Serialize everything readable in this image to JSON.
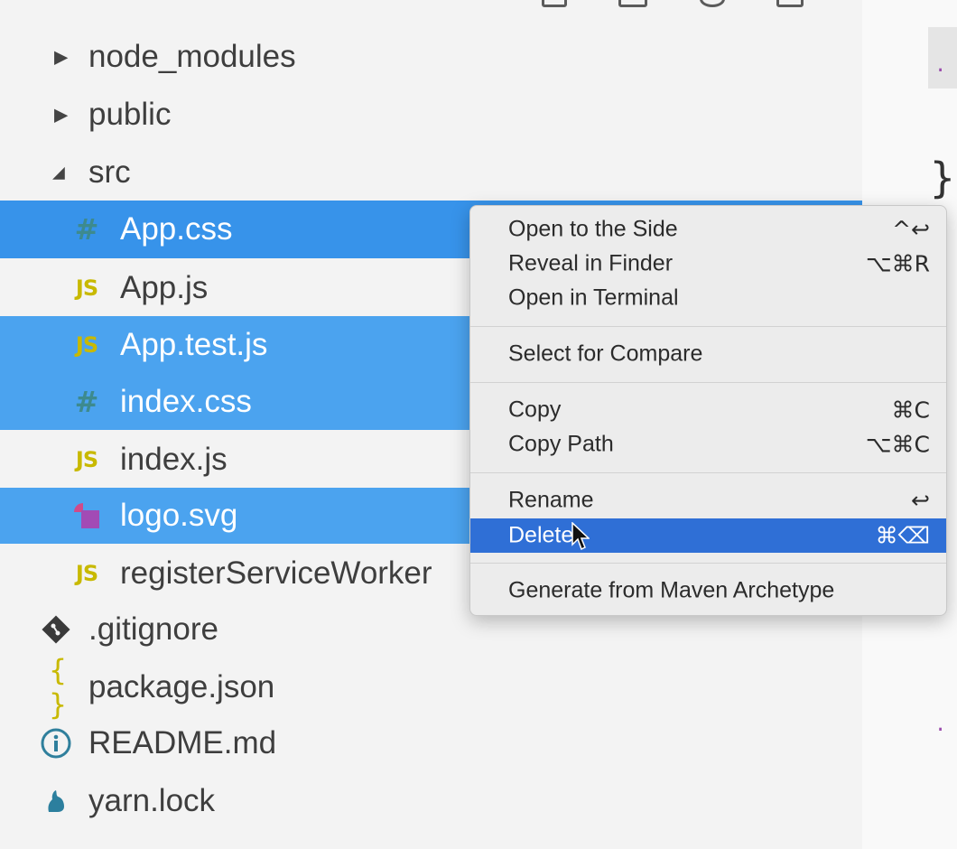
{
  "explorer": {
    "items": [
      {
        "label": "node_modules",
        "twisty": "▶",
        "icon": "",
        "indent": "folder"
      },
      {
        "label": "public",
        "twisty": "▶",
        "icon": "",
        "indent": "folder"
      },
      {
        "label": "src",
        "twisty": "◢",
        "icon": "",
        "indent": "folder"
      },
      {
        "label": "App.css",
        "icon": "#",
        "icon_name": "css-icon"
      },
      {
        "label": "App.js",
        "icon": "JS",
        "icon_name": "js-icon"
      },
      {
        "label": "App.test.js",
        "icon": "JS",
        "icon_name": "js-icon"
      },
      {
        "label": "index.css",
        "icon": "#",
        "icon_name": "css-icon"
      },
      {
        "label": "index.js",
        "icon": "JS",
        "icon_name": "js-icon"
      },
      {
        "label": "logo.svg",
        "icon": "",
        "icon_name": "svg-icon"
      },
      {
        "label": "registerServiceWorker",
        "icon": "JS",
        "icon_name": "js-icon"
      },
      {
        "label": ".gitignore",
        "icon": "",
        "icon_name": "git-icon"
      },
      {
        "label": "package.json",
        "icon": "{ }",
        "icon_name": "json-icon"
      },
      {
        "label": "README.md",
        "icon": "",
        "icon_name": "info-icon"
      },
      {
        "label": "yarn.lock",
        "icon": "",
        "icon_name": "yarn-icon"
      }
    ],
    "selected": [
      "App.css",
      "App.test.js",
      "index.css",
      "logo.svg"
    ]
  },
  "context_menu": {
    "groups": [
      [
        {
          "label": "Open to the Side",
          "shortcut": "^↩"
        },
        {
          "label": "Reveal in Finder",
          "shortcut": "⌥⌘R"
        },
        {
          "label": "Open in Terminal",
          "shortcut": ""
        }
      ],
      [
        {
          "label": "Select for Compare",
          "shortcut": ""
        }
      ],
      [
        {
          "label": "Copy",
          "shortcut": "⌘C"
        },
        {
          "label": "Copy Path",
          "shortcut": "⌥⌘C"
        }
      ],
      [
        {
          "label": "Rename",
          "shortcut": "↩"
        },
        {
          "label": "Delete",
          "shortcut": "⌘⌫"
        }
      ],
      [
        {
          "label": "Generate from Maven Archetype",
          "shortcut": ""
        }
      ]
    ],
    "highlighted": "Delete"
  },
  "editor": {
    "glyphs": [
      ".",
      "}",
      ".",
      "}",
      "."
    ]
  },
  "colors": {
    "selection": "#4ba3ef",
    "menu_highlight": "#2f6fd6",
    "js_icon": "#c8b900",
    "css_icon": "#3d8a8e",
    "svg_icon": "#a24bb5"
  }
}
